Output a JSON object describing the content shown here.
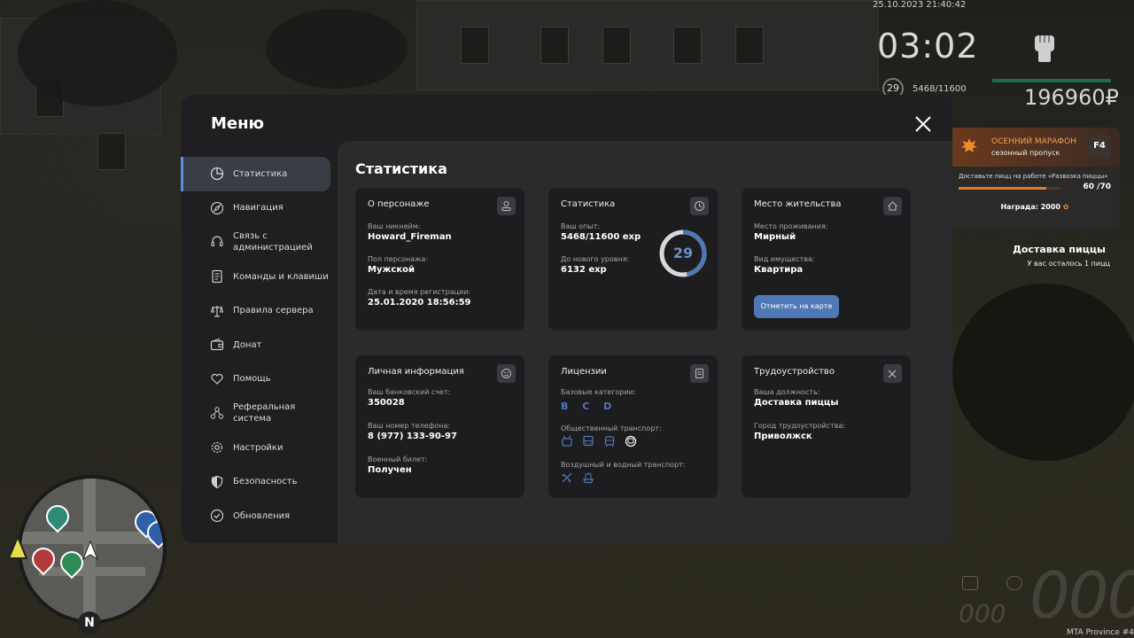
{
  "hud": {
    "datetime": "25.10.2023 21:40:42",
    "clock": "03:02",
    "level": "29",
    "exp": "5468/11600",
    "money": "196960₽",
    "speed": "000",
    "fuel": "000",
    "brand": "MTA Province #4"
  },
  "season_pass": {
    "title": "ОСЕННИЙ МАРАФОН",
    "subtitle": "сезонный пропуск",
    "key": "F4",
    "task": "Доставьте пицц на работе «Развозка пиццы»",
    "progress_text": "60 /70",
    "progress": 0.857,
    "reward": "Награда: 2000"
  },
  "quest": {
    "title": "Доставка пиццы",
    "subtitle": "У вас осталось 1 пицц"
  },
  "minimap": {
    "north": "N"
  },
  "menu": {
    "title": "Меню",
    "nav": [
      {
        "label": "Статистика"
      },
      {
        "label": "Навигация"
      },
      {
        "label": "Связь с администрацией"
      },
      {
        "label": "Команды и клавиши"
      },
      {
        "label": "Правила сервера"
      },
      {
        "label": "Донат"
      },
      {
        "label": "Помощь"
      },
      {
        "label": "Реферальная система"
      },
      {
        "label": "Настройки"
      },
      {
        "label": "Безопасность"
      },
      {
        "label": "Обновления"
      }
    ],
    "content_title": "Статистика",
    "cards": {
      "character": {
        "title": "О персонаже",
        "nick_label": "Ваш никнейм:",
        "nick": "Howard_Fireman",
        "gender_label": "Пол персонажа:",
        "gender": "Мужской",
        "reg_label": "Дата и время регистрации:",
        "reg": "25.01.2020 18:56:59"
      },
      "stats": {
        "title": "Статистика",
        "exp_label": "Ваш опыт:",
        "exp": "5468/11600 exp",
        "next_label": "До нового уровня:",
        "next": "6132 exp",
        "level": "29",
        "level_progress": 0.471
      },
      "residence": {
        "title": "Место жительства",
        "place_label": "Место проживания:",
        "place": "Мирный",
        "prop_label": "Вид имущества:",
        "prop": "Квартира",
        "button": "Отметить на карте"
      },
      "personal": {
        "title": "Личная информация",
        "bank_label": "Ваш банковский счет:",
        "bank": "350028",
        "phone_label": "Ваш номер телефона:",
        "phone": "8 (977) 133-90-97",
        "military_label": "Военный билет:",
        "military": "Получен"
      },
      "licenses": {
        "title": "Лицензии",
        "base_label": "Базовые категории:",
        "base": "B C D",
        "public_label": "Общественный транспорт:",
        "air_label": "Воздушный и водный транспорт:"
      },
      "job": {
        "title": "Трудоустройство",
        "position_label": "Ваша должность:",
        "position": "Доставка пиццы",
        "city_label": "Город трудоустройства:",
        "city": "Приволжск"
      }
    }
  },
  "colors": {
    "accent": "#5b8de8",
    "button": "#4f78b6",
    "season": "#e47a2e"
  }
}
